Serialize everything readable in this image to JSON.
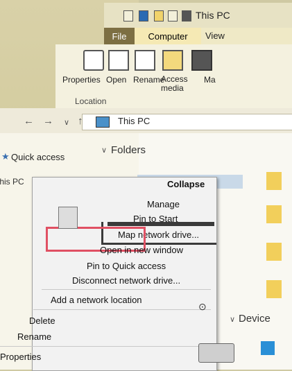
{
  "window": {
    "title": "This PC"
  },
  "tabs": {
    "file": "File",
    "computer": "Computer",
    "view": "View"
  },
  "ribbon": {
    "properties": "Properties",
    "open": "Open",
    "rename": "Rename",
    "access_media": "Access media",
    "map": "Ma",
    "group_location": "Location"
  },
  "address": {
    "path": "This PC"
  },
  "nav": {
    "quick_access": "Quick access",
    "this_pc": "This PC",
    "folders": "Folders",
    "devices": "Device"
  },
  "context_menu": {
    "collapse": "Collapse",
    "manage": "Manage",
    "pin_to_start": "Pin to Start",
    "map_network_drive": "Map network drive...",
    "open_new_window": "Open in new window",
    "pin_quick_access": "Pin to Quick access",
    "disconnect": "Disconnect network drive...",
    "add_network_location": "Add a network location",
    "delete": "Delete",
    "rename": "Rename",
    "properties": "Properties"
  },
  "colors": {
    "file_tab": "#7d6f43",
    "highlight": "#e05063",
    "accent": "#3a6fb0"
  }
}
